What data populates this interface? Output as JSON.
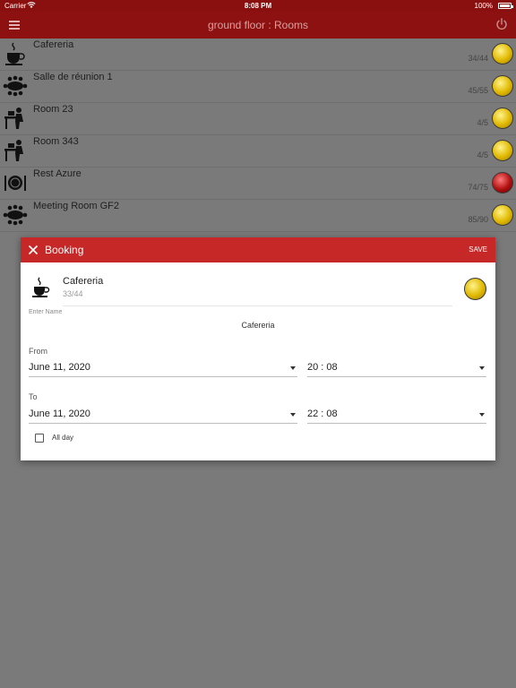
{
  "status": {
    "carrier": "Carrier",
    "time": "8:08 PM",
    "battery": "100%"
  },
  "appbar": {
    "title": "ground floor : Rooms",
    "menu_icon": "menu-icon",
    "power_icon": "power-icon"
  },
  "colors": {
    "appbar": "#8d1111",
    "dialog_header": "#c62828",
    "yellow": "#e0b800",
    "red": "#b01010",
    "overlay": "#7a7a7a"
  },
  "rooms": [
    {
      "name": "Cafereria",
      "count": "34/44",
      "icon": "coffee-cup-icon",
      "status": "yellow"
    },
    {
      "name": "Salle de réunion 1",
      "count": "45/55",
      "icon": "meeting-table-icon",
      "status": "yellow"
    },
    {
      "name": "Room 23",
      "count": "4/5",
      "icon": "desk-person-icon",
      "status": "yellow"
    },
    {
      "name": "Room 343",
      "count": "4/5",
      "icon": "desk-person-icon",
      "status": "yellow"
    },
    {
      "name": "Rest Azure",
      "count": "74/75",
      "icon": "plate-cutlery-icon",
      "status": "red"
    },
    {
      "name": "Meeting Room GF2",
      "count": "85/90",
      "icon": "meeting-table-icon",
      "status": "yellow"
    }
  ],
  "dialog": {
    "title": "Booking",
    "save": "SAVE",
    "room_name": "Cafereria",
    "room_count": "33/44",
    "name_label": "Enter Name",
    "name_value": "Cafereria",
    "from_label": "From",
    "from_date": "June 11, 2020",
    "from_time": "20 : 08",
    "to_label": "To",
    "to_date": "June 11, 2020",
    "to_time": "22 : 08",
    "allday_label": "All day",
    "allday_checked": false
  }
}
